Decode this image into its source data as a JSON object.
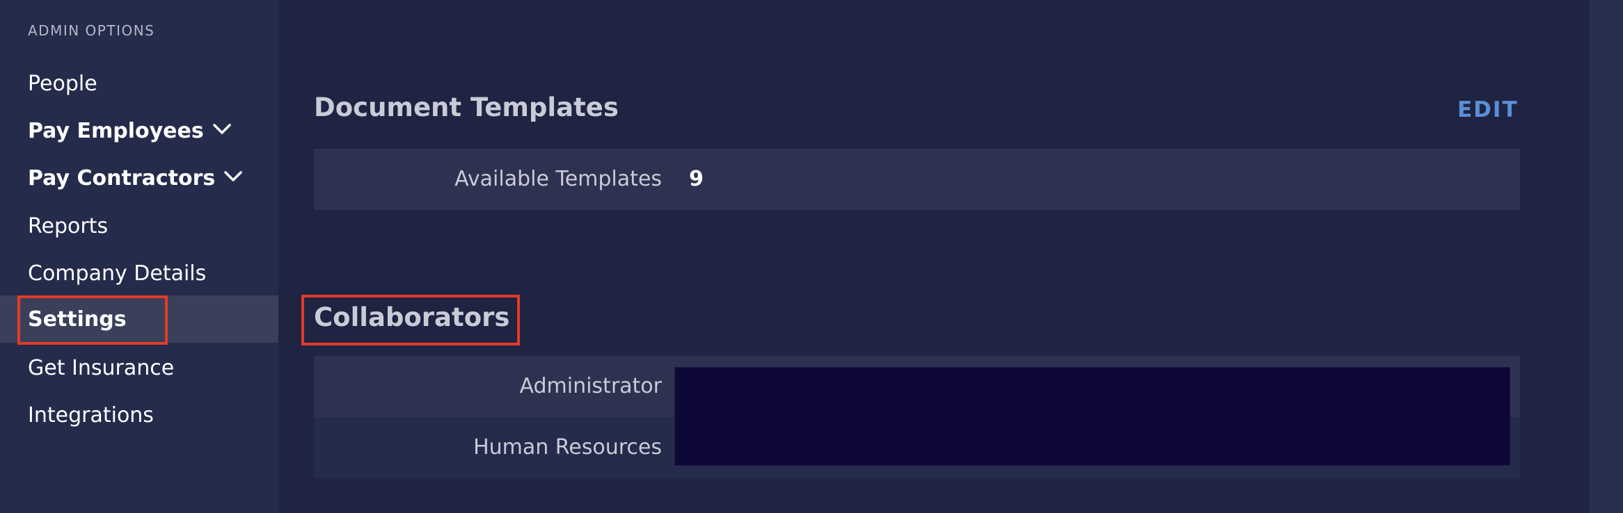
{
  "sidebar": {
    "heading": "ADMIN OPTIONS",
    "items": [
      {
        "label": "People",
        "bold": false,
        "expandable": false,
        "active": false
      },
      {
        "label": "Pay Employees",
        "bold": true,
        "expandable": true,
        "active": false
      },
      {
        "label": "Pay Contractors",
        "bold": true,
        "expandable": true,
        "active": false
      },
      {
        "label": "Reports",
        "bold": false,
        "expandable": false,
        "active": false
      },
      {
        "label": "Company Details",
        "bold": false,
        "expandable": false,
        "active": false
      },
      {
        "label": "Settings",
        "bold": true,
        "expandable": false,
        "active": true
      },
      {
        "label": "Get Insurance",
        "bold": false,
        "expandable": false,
        "active": false
      },
      {
        "label": "Integrations",
        "bold": false,
        "expandable": false,
        "active": false
      }
    ]
  },
  "document_templates": {
    "title": "Document Templates",
    "edit_label": "EDIT",
    "rows": [
      {
        "label": "Available Templates",
        "value": "9"
      }
    ]
  },
  "collaborators": {
    "title": "Collaborators",
    "rows": [
      {
        "label": "Administrator",
        "value": ""
      },
      {
        "label": "Human Resources",
        "value": ""
      }
    ],
    "values_redacted": true
  },
  "annotations": {
    "highlight_color": "#e23b27",
    "highlighted": [
      "Settings",
      "Collaborators"
    ]
  },
  "colors": {
    "sidebar_bg": "#252b4b",
    "main_bg": "#1f2442",
    "active_item_bg": "#3a3f5a",
    "panel_bg": "#2e3150",
    "accent": "#5b8fd9",
    "redaction": "#0e0838"
  }
}
